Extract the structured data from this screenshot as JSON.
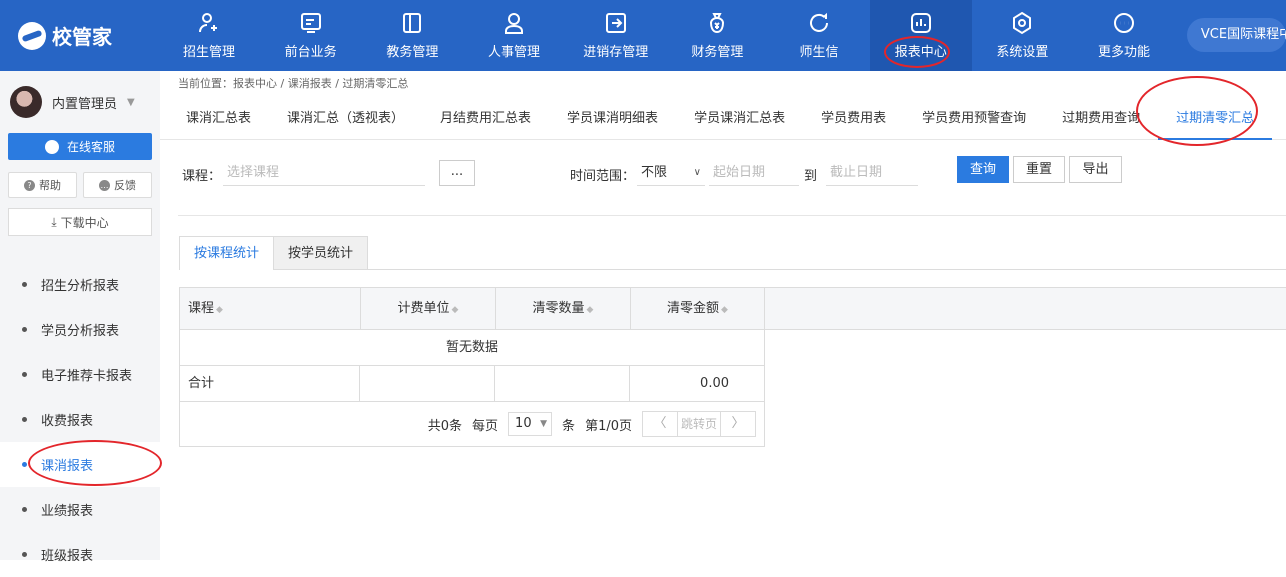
{
  "app": {
    "logo": "校管家",
    "school": "VCE国际课程中心"
  },
  "topnav": [
    {
      "label": "招生管理",
      "icon": "user-add-icon"
    },
    {
      "label": "前台业务",
      "icon": "monitor-icon"
    },
    {
      "label": "教务管理",
      "icon": "book-icon"
    },
    {
      "label": "人事管理",
      "icon": "person-icon"
    },
    {
      "label": "进销存管理",
      "icon": "inventory-icon"
    },
    {
      "label": "财务管理",
      "icon": "money-bag-icon"
    },
    {
      "label": "师生信",
      "icon": "chat-icon"
    },
    {
      "label": "报表中心",
      "icon": "report-icon"
    },
    {
      "label": "系统设置",
      "icon": "settings-icon"
    },
    {
      "label": "更多功能",
      "icon": "more-icon"
    }
  ],
  "sidebar": {
    "username": "内置管理员",
    "kefu": "在线客服",
    "help": "帮助",
    "feedback": "反馈",
    "download": "下载中心",
    "items": [
      "招生分析报表",
      "学员分析报表",
      "电子推荐卡报表",
      "收费报表",
      "课消报表",
      "业绩报表",
      "班级报表"
    ],
    "active_index": 4
  },
  "breadcrumb": "当前位置：报表中心 / 课消报表 / 过期清零汇总",
  "tabs": [
    "课消汇总表",
    "课消汇总（透视表）",
    "月结费用汇总表",
    "学员课消明细表",
    "学员课消汇总表",
    "学员费用表",
    "学员费用预警查询",
    "过期费用查询",
    "过期清零汇总"
  ],
  "active_tab": 8,
  "filters": {
    "course_label": "课程：",
    "course_placeholder": "选择课程",
    "dots": "...",
    "time_label": "时间范围：",
    "time_value": "不限",
    "start_placeholder": "起始日期",
    "to": "到",
    "end_placeholder": "截止日期",
    "query": "查询",
    "reset": "重置",
    "export": "导出"
  },
  "subtabs": [
    "按课程统计",
    "按学员统计"
  ],
  "table": {
    "headers": [
      "课程",
      "计费单位",
      "清零数量",
      "清零金额"
    ],
    "empty": "暂无数据",
    "total_label": "合计",
    "total_amount": "0.00"
  },
  "pager": {
    "total": "共0条",
    "per_page_label": "每页",
    "per_page": "10",
    "unit": "条",
    "page": "第1/0页",
    "prev": "〈",
    "jump": "跳转页",
    "next": "〉"
  }
}
